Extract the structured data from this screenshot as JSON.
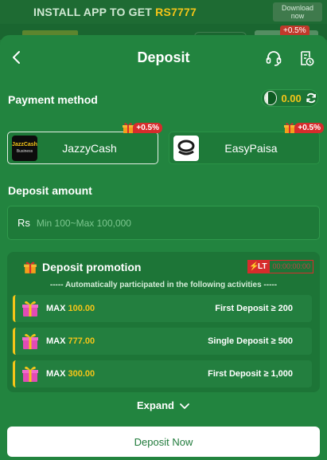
{
  "banner": {
    "text_prefix": "INSTALL APP TO GET",
    "text_amount": "RS7777",
    "download_line1": "Download",
    "download_line2": "now"
  },
  "background_badge": "+0.5%",
  "header": {
    "title": "Deposit",
    "back_icon": "chevron-left-icon",
    "support_icon": "headset-icon",
    "history_icon": "receipt-clock-icon"
  },
  "payment": {
    "label": "Payment method",
    "balance": "0.00",
    "methods": [
      {
        "name": "JazzyCash",
        "logo_text_top": "JazzCash",
        "logo_text_bottom": "Business",
        "bonus": "+0.5%",
        "selected": true
      },
      {
        "name": "EasyPaisa",
        "bonus": "+0.5%",
        "selected": false
      }
    ]
  },
  "amount": {
    "label": "Deposit amount",
    "currency": "Rs",
    "placeholder": "Min 100~Max 100,000"
  },
  "promotion": {
    "title": "Deposit promotion",
    "lt_label": "LT",
    "lt_time": "00:00:00:00",
    "note": "----- Automatically participated in the following activities -----",
    "max_label": "MAX",
    "items": [
      {
        "max": "100.00",
        "condition": "First Deposit ≥ 200"
      },
      {
        "max": "777.00",
        "condition": "Single Deposit ≥ 500"
      },
      {
        "max": "300.00",
        "condition": "First Deposit ≥ 1,000"
      }
    ]
  },
  "expand_label": "Expand",
  "submit_label": "Deposit Now",
  "colors": {
    "background": "#22843f",
    "accent_gold": "#f5c518",
    "badge_red": "#d62c2c"
  }
}
